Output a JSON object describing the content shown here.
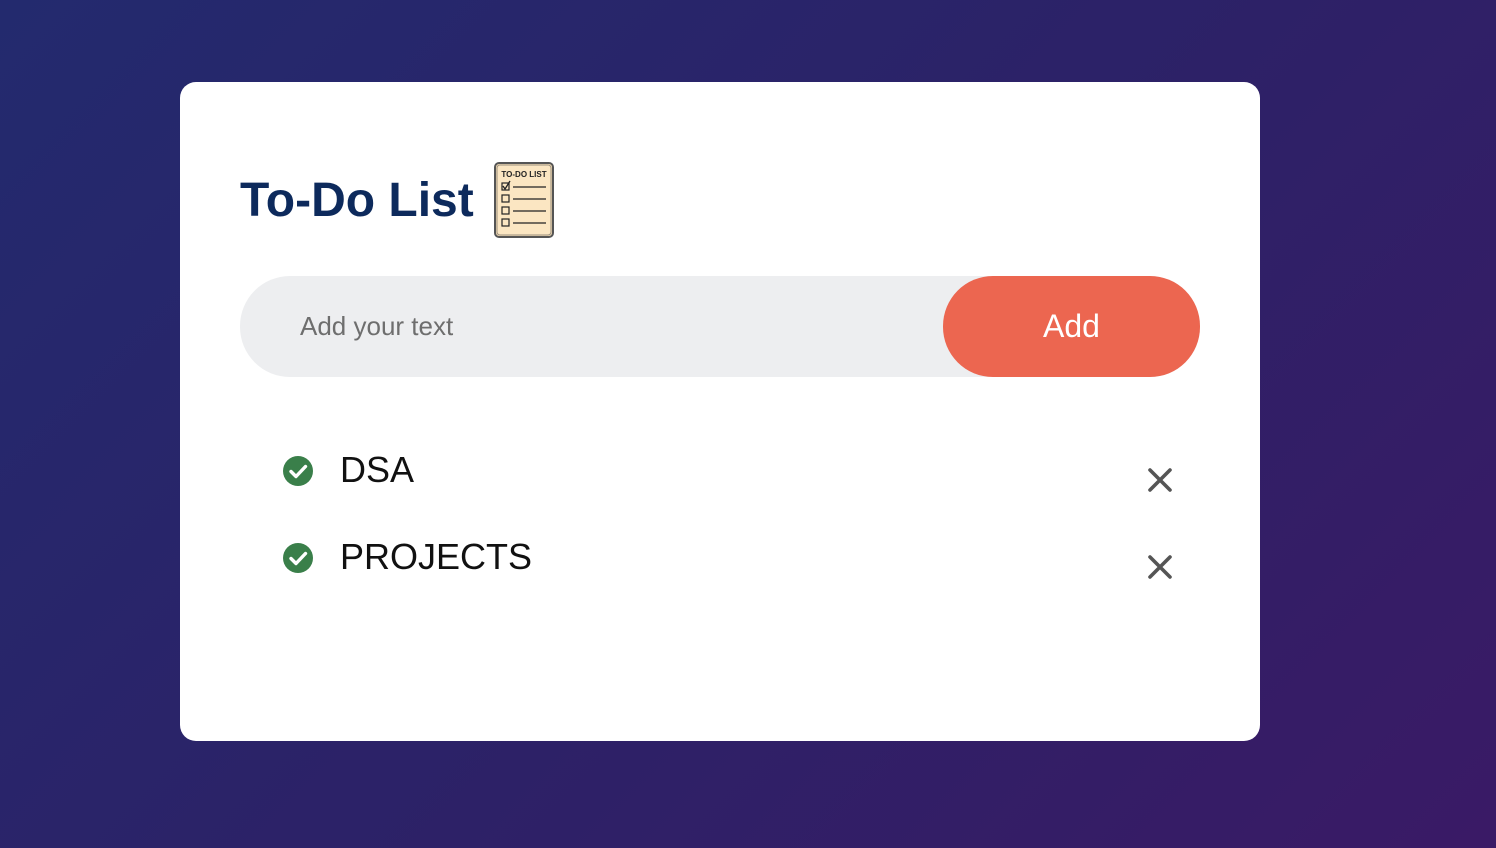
{
  "app": {
    "title": "To-Do List",
    "title_icon": "clipboard-checklist-icon",
    "title_icon_text": "TO-DO LIST"
  },
  "input": {
    "placeholder": "Add your text",
    "value": ""
  },
  "add_button": {
    "label": "Add"
  },
  "tasks": [
    {
      "label": "DSA",
      "checked": true,
      "check_icon": "check-circle-icon",
      "delete_icon": "close-icon"
    },
    {
      "label": "PROJECTS",
      "checked": true,
      "check_icon": "check-circle-icon",
      "delete_icon": "close-icon"
    }
  ],
  "colors": {
    "background_start": "#232a6e",
    "background_end": "#3a1a66",
    "card": "#ffffff",
    "title": "#0d2a5c",
    "input_bg": "#edeef0",
    "accent": "#ec6650",
    "check": "#3a7f4a",
    "delete": "#555555"
  }
}
